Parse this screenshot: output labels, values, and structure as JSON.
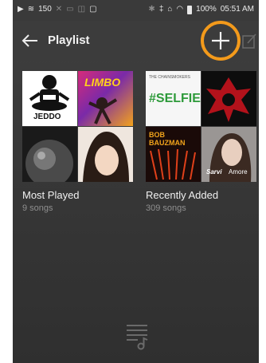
{
  "status_bar": {
    "volume": "150",
    "time": "05:51 AM",
    "battery": "100%"
  },
  "header": {
    "title": "Playlist",
    "icons": [
      "back-arrow-icon",
      "add-icon",
      "edit-icon"
    ],
    "highlight_color": "#f39a1b"
  },
  "playlists": [
    {
      "name": "Most Played",
      "count": "9 songs",
      "covers": [
        {
          "text": "JEDDO"
        },
        {
          "text": "LIMBO"
        },
        {
          "text": ""
        },
        {
          "text": ""
        }
      ]
    },
    {
      "name": "Recently Added",
      "count": "309 songs",
      "covers": [
        {
          "text": "THE CHAINSMOKERS",
          "text2": "#SELFIE"
        },
        {
          "text": ""
        },
        {
          "text": "BOB BAUZMAN"
        },
        {
          "text": "Sarvi",
          "text2": "Amore"
        }
      ]
    }
  ],
  "footer": {
    "icon": "music-queue-icon"
  }
}
